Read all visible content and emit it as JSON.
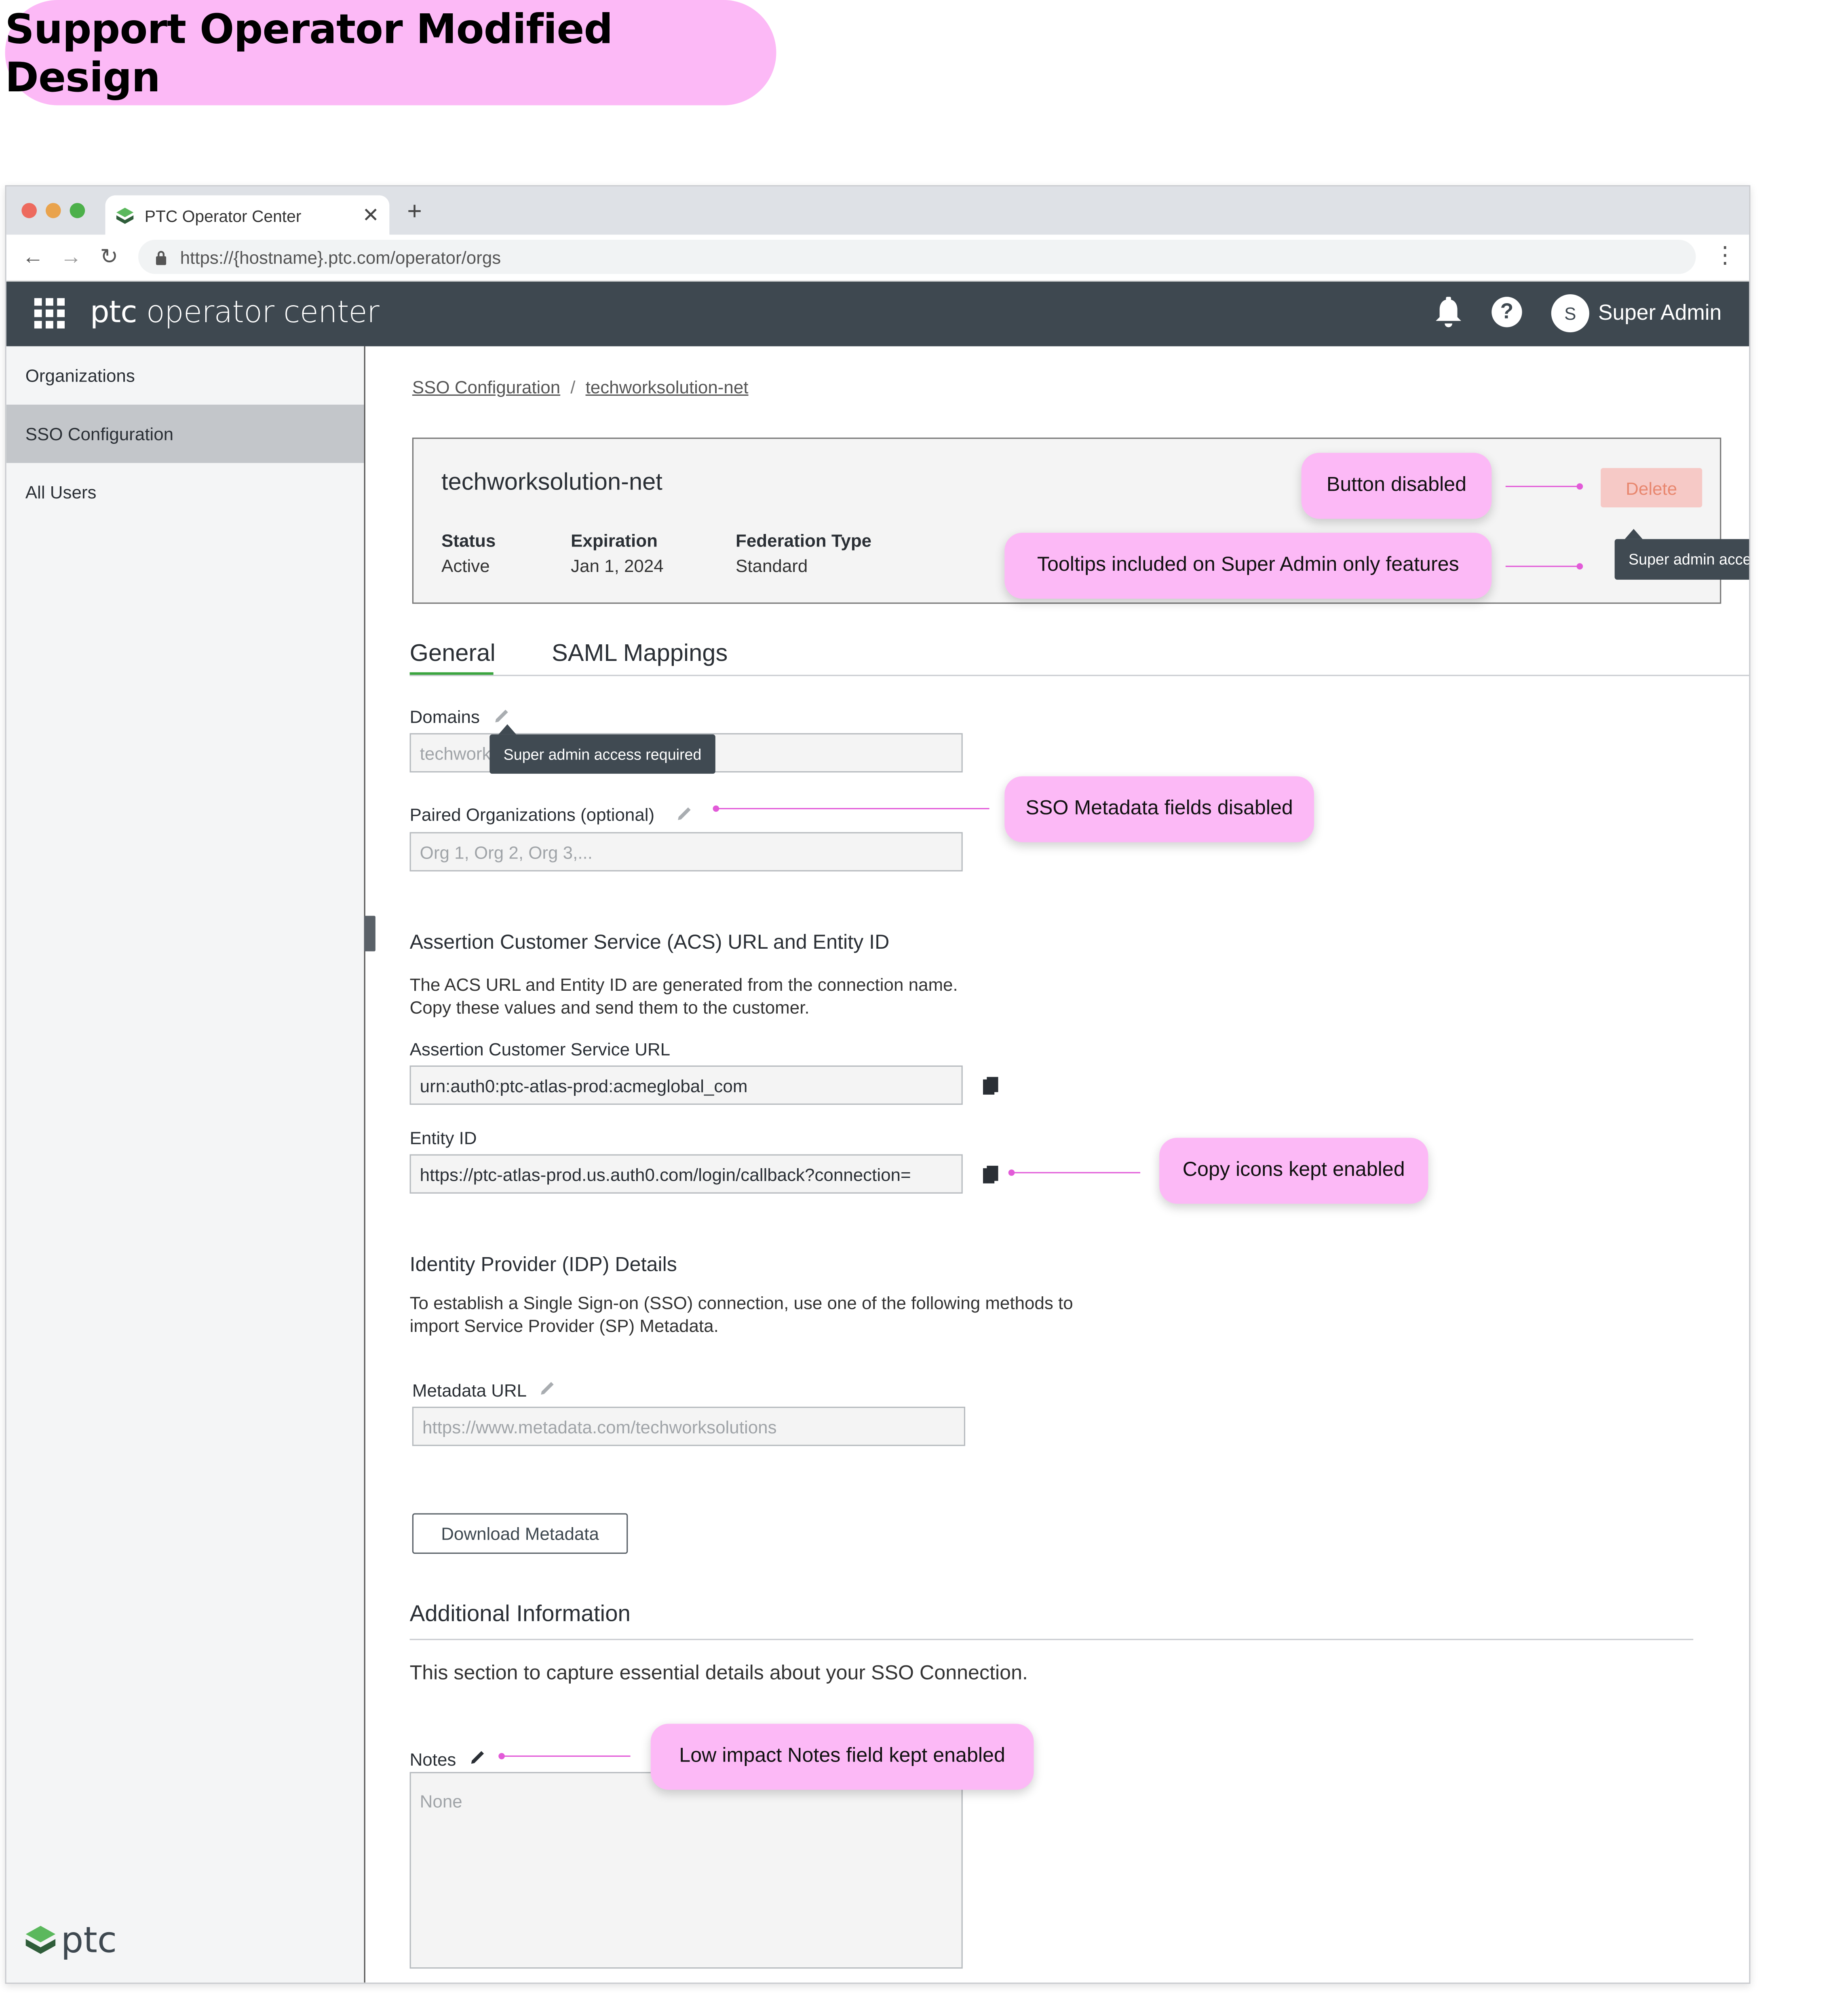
{
  "title": "Support Operator Modified Design",
  "browser": {
    "tab_title": "PTC Operator Center",
    "url": "https://{hostname}.ptc.com/operator/orgs"
  },
  "appbar": {
    "brand_ptc": "ptc",
    "brand_rest": "operator center",
    "avatar_initial": "S",
    "user_name": "Super Admin"
  },
  "sidebar": {
    "items": [
      {
        "label": "Organizations"
      },
      {
        "label": "SSO Configuration"
      },
      {
        "label": "All Users"
      }
    ],
    "footer_logo": "ptc"
  },
  "breadcrumb": {
    "parent": "SSO Configuration",
    "separator": "/",
    "current": "techworksolution-net"
  },
  "header_card": {
    "name": "techworksolution-net",
    "status_label": "Status",
    "status_value": "Active",
    "expiration_label": "Expiration",
    "expiration_value": "Jan 1, 2024",
    "federation_label": "Federation Type",
    "federation_value": "Standard",
    "delete_label": "Delete"
  },
  "tooltips": {
    "super_admin": "Super admin access required"
  },
  "tabs": [
    {
      "label": "General",
      "active": true
    },
    {
      "label": "SAML Mappings",
      "active": false
    }
  ],
  "domains": {
    "label": "Domains",
    "placeholder": "techworksolution.net"
  },
  "paired_orgs": {
    "label": "Paired Organizations (optional)",
    "placeholder": "Org 1, Org 2, Org 3,..."
  },
  "acs": {
    "heading": "Assertion Customer Service (ACS) URL and Entity ID",
    "desc_line1": "The ACS URL and Entity ID are generated from the connection name.",
    "desc_line2": "Copy these values and send them to the customer.",
    "url_label": "Assertion Customer Service URL",
    "url_value": "urn:auth0:ptc-atlas-prod:acmeglobal_com",
    "entity_label": "Entity ID",
    "entity_value": "https://ptc-atlas-prod.us.auth0.com/login/callback?connection="
  },
  "idp": {
    "heading": "Identity Provider (IDP) Details",
    "desc_line1": "To establish a Single Sign-on (SSO) connection, use one of the following methods to",
    "desc_line2": "import Service Provider (SP) Metadata.",
    "metadata_label": "Metadata URL",
    "metadata_placeholder": "https://www.metadata.com/techworksolutions",
    "download_label": "Download Metadata"
  },
  "additional": {
    "heading": "Additional Information",
    "desc": "This section to capture essential details about your SSO Connection.",
    "notes_label": "Notes",
    "notes_placeholder": "None"
  },
  "callouts": {
    "button_disabled": "Button disabled",
    "tooltips_included": "Tooltips included on Super Admin only features",
    "sso_disabled": "SSO Metadata fields disabled",
    "copy_enabled": "Copy icons kept enabled",
    "notes_enabled": "Low impact Notes field kept enabled"
  },
  "colors": {
    "callout": "#fcb9f6",
    "appbar": "#3e4850",
    "active_tab": "#3aa53f",
    "delete_bg": "#f6c9c6",
    "delete_text": "#e8876f",
    "leader": "#e25ad8"
  },
  "icons": [
    "apps-grid-icon",
    "bell-icon",
    "help-icon",
    "pencil-icon",
    "copy-icon",
    "lock-icon",
    "back-icon",
    "forward-icon",
    "reload-icon",
    "more-icon",
    "close-icon",
    "plus-icon",
    "ptc-logo-icon"
  ]
}
